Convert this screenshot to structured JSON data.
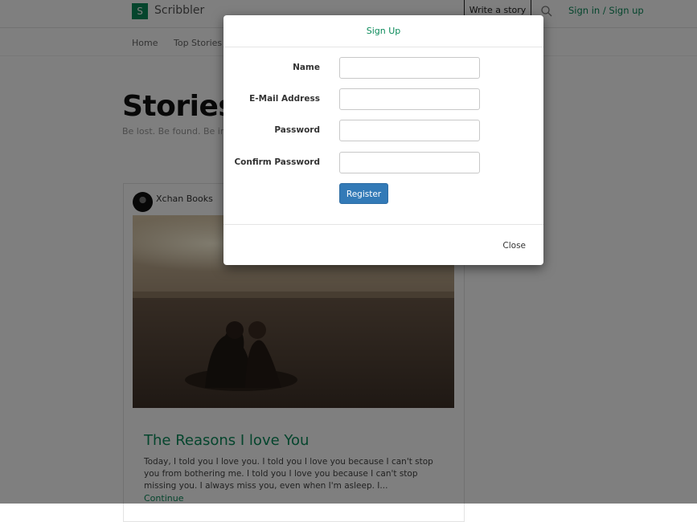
{
  "app": {
    "logo_letter": "S",
    "name": "Scribbler"
  },
  "header": {
    "write_label": "Write a story",
    "signin_label": "Sign in / Sign up"
  },
  "nav": {
    "items": [
      "Home",
      "Top Stories"
    ]
  },
  "hero": {
    "title": "Stories",
    "subtitle": "Be lost. Be found. Be ins"
  },
  "card": {
    "author": "Xchan Books",
    "title": "The Reasons I love You",
    "excerpt": "Today, I told you I love you. I told you I love you because I can't stop you from bothering me. I told you I love you because I can't stop missing you. I always miss you, even when I'm asleep. I...",
    "continue_label": "Continue"
  },
  "modal": {
    "title": "Sign Up",
    "fields": [
      {
        "label": "Name",
        "value": "",
        "placeholder": ""
      },
      {
        "label": "E-Mail Address",
        "value": "",
        "placeholder": ""
      },
      {
        "label": "Password",
        "value": "",
        "placeholder": ""
      },
      {
        "label": "Confirm Password",
        "value": "",
        "placeholder": ""
      }
    ],
    "register_label": "Register",
    "close_label": "Close"
  },
  "colors": {
    "brand": "#0a8a5a",
    "primary_button": "#337ab7",
    "backdrop": "rgba(0,0,0,0.5)"
  }
}
